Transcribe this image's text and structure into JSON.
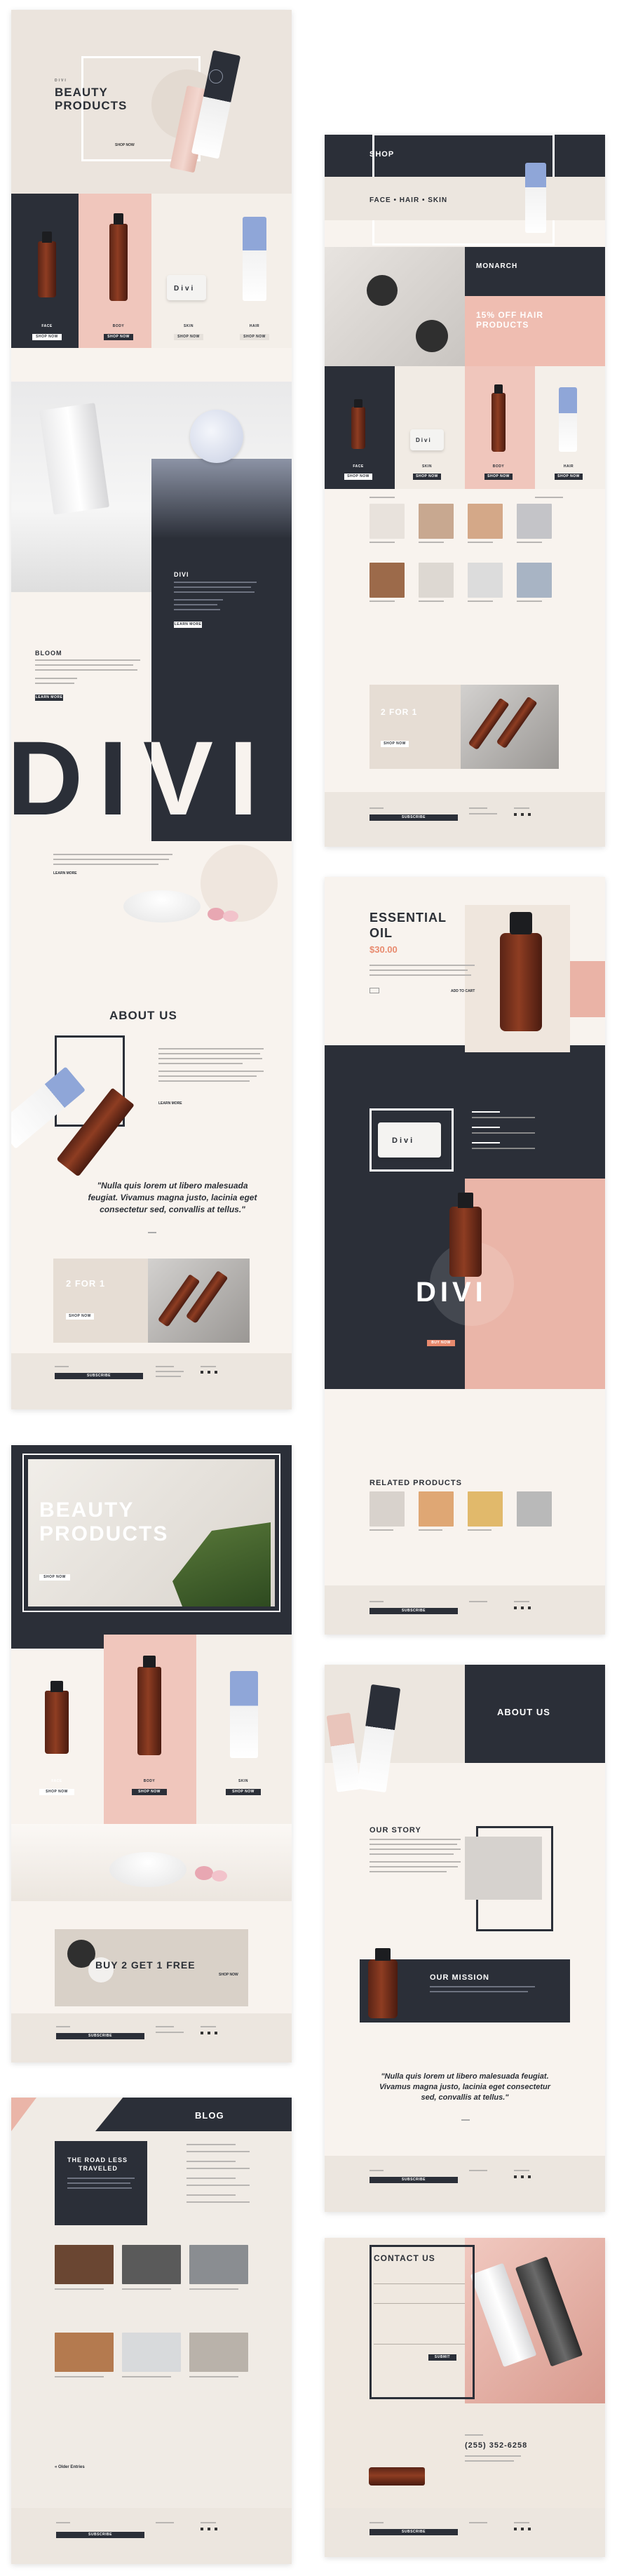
{
  "p1": {
    "hero_kicker": "DIVI",
    "hero_title_1": "BEAUTY",
    "hero_title_2": "PRODUCTS",
    "hero_link": "SHOP NOW",
    "products": [
      {
        "label": "FACE",
        "btn": "SHOP NOW"
      },
      {
        "label": "BODY",
        "btn": "SHOP NOW"
      },
      {
        "label": "SKIN",
        "btn": "SHOP NOW"
      },
      {
        "label": "HAIR",
        "btn": "SHOP NOW"
      }
    ],
    "jar_text": "Divi",
    "divi_heading": "DIVI",
    "bloom_heading": "BLOOM",
    "big_divi": "DIVI",
    "read_more": "LEARN MORE",
    "about_heading": "ABOUT US",
    "quote": "\"Nulla quis lorem ut libero malesuada feugiat. Vivamus magna justo, lacinia eget consectetur sed, convallis at tellus.\"",
    "promo_title": "2 FOR 1",
    "promo_btn": "SHOP NOW",
    "footer_subscribe": "SUBSCRIBE"
  },
  "p2": {
    "shop_heading": "SHOP",
    "banner": "FACE • HAIR • SKIN",
    "monarch": "MONARCH",
    "sale": "15% OFF HAIR PRODUCTS",
    "products": [
      {
        "label": "FACE",
        "btn": "SHOP NOW"
      },
      {
        "label": "SKIN",
        "btn": "SHOP NOW"
      },
      {
        "label": "BODY",
        "btn": "SHOP NOW"
      },
      {
        "label": "HAIR",
        "btn": "SHOP NOW"
      }
    ],
    "jar_text": "Divi",
    "promo_title": "2 FOR 1",
    "promo_btn": "SHOP NOW",
    "footer_subscribe": "SUBSCRIBE"
  },
  "p3": {
    "title_1": "ESSENTIAL",
    "title_2": "OIL",
    "price": "$30.00",
    "add_btn": "ADD TO CART",
    "jar_text": "Divi",
    "big_divi": "DIVI",
    "buy_btn": "BUY NOW",
    "related": "RELATED PRODUCTS",
    "footer_subscribe": "SUBSCRIBE"
  },
  "p4": {
    "title_1": "BEAUTY",
    "title_2": "PRODUCTS",
    "hero_btn": "SHOP NOW",
    "products": [
      {
        "label": "FACE",
        "btn": "SHOP NOW"
      },
      {
        "label": "BODY",
        "btn": "SHOP NOW"
      },
      {
        "label": "SKIN",
        "btn": "SHOP NOW"
      }
    ],
    "promo": "BUY 2 GET 1 FREE",
    "promo_link": "SHOP NOW",
    "footer_subscribe": "SUBSCRIBE"
  },
  "p5": {
    "about_heading": "ABOUT US",
    "story_heading": "OUR STORY",
    "mission_heading": "OUR MISSION",
    "quote": "\"Nulla quis lorem ut libero malesuada feugiat. Vivamus magna justo, lacinia eget consectetur sed, convallis at tellus.\"",
    "footer_subscribe": "SUBSCRIBE"
  },
  "p6": {
    "blog_heading": "BLOG",
    "featured_1": "THE ROAD LESS",
    "featured_2": "TRAVELED",
    "older": "« Older Entries",
    "footer_subscribe": "SUBSCRIBE"
  },
  "p7": {
    "contact_heading": "CONTACT US",
    "phone": "(255) 352-6258",
    "submit": "SUBMIT",
    "footer_subscribe": "SUBSCRIBE"
  },
  "colors": {
    "navy": "#2b2f38",
    "pink": "#eab5a8",
    "cream": "#f6f0ea",
    "accent_orange": "#e88a6e"
  }
}
